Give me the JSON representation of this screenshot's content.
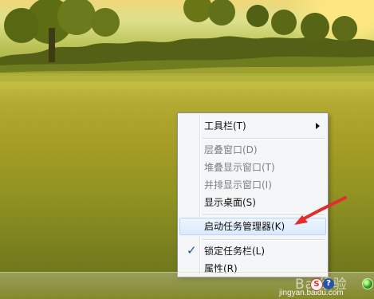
{
  "context_menu": {
    "items": [
      {
        "label": "工具栏(T)",
        "state": "submenu"
      },
      {
        "label": "层叠窗口(D)",
        "state": "disabled"
      },
      {
        "label": "堆叠显示窗口(T)",
        "state": "disabled"
      },
      {
        "label": "并排显示窗口(I)",
        "state": "disabled"
      },
      {
        "label": "显示桌面(S)",
        "state": "enabled"
      },
      {
        "label": "启动任务管理器(K)",
        "state": "highlighted"
      },
      {
        "label": "锁定任务栏(L)",
        "state": "checked"
      },
      {
        "label": "属性(R)",
        "state": "enabled"
      }
    ],
    "check_glyph": "✓"
  },
  "watermark": {
    "logo": "Bai经验",
    "text": "jingyan.baidu.com"
  },
  "tray": {
    "icons": [
      {
        "name": "sogou-icon",
        "glyph": "S"
      },
      {
        "name": "help-icon",
        "glyph": "?"
      },
      {
        "name": "network-icon"
      }
    ]
  },
  "colors": {
    "menu_background": "#f5f6f8",
    "highlight": "#dbeafc",
    "arrow": "#e12d2d",
    "grass": "#a59d25"
  }
}
